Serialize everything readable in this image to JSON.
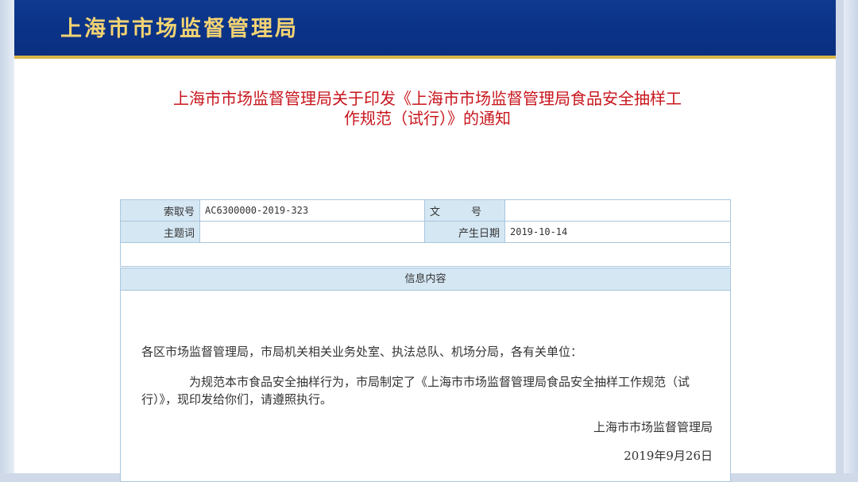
{
  "header": {
    "title": "上海市市场监督管理局"
  },
  "doc": {
    "title_line1": "上海市市场监督管理局关于印发《上海市市场监督管理局食品安全抽样工",
    "title_line2": "作规范（试行）》的通知"
  },
  "meta": {
    "index_label": "索取号",
    "index_value": "AC6300000-2019-323",
    "doc_no_label": "文　　　号",
    "doc_no_value": "",
    "subject_label": "主题词",
    "subject_value": "",
    "date_label": "产生日期",
    "date_value": "2019-10-14"
  },
  "content": {
    "header": "信息内容",
    "salutation": "各区市场监督管理局，市局机关相关业务处室、执法总队、机场分局，各有关单位：",
    "body": "为规范本市食品安全抽样行为，市局制定了《上海市市场监督管理局食品安全抽样工作规范（试行）》，现印发给你们，请遵照执行。",
    "signature_org": "上海市市场监督管理局",
    "signature_date": "2019年9月26日"
  }
}
